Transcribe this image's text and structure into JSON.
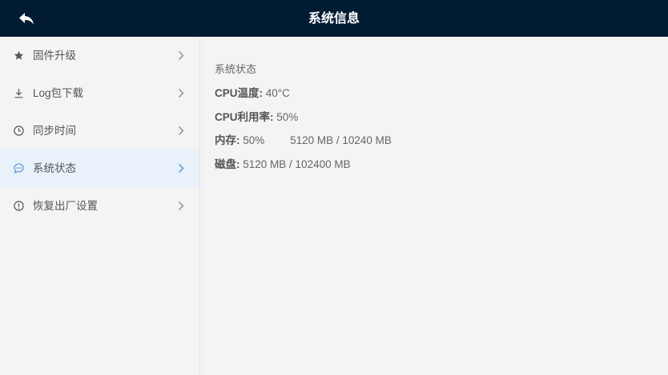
{
  "header": {
    "title": "系统信息",
    "back_icon": "reply-arrow-icon"
  },
  "sidebar": {
    "items": [
      {
        "label": "固件升级",
        "icon": "star-icon",
        "active": false
      },
      {
        "label": "Log包下载",
        "icon": "download-icon",
        "active": false
      },
      {
        "label": "同步时间",
        "icon": "clock-icon",
        "active": false
      },
      {
        "label": "系统状态",
        "icon": "chat-bubble-icon",
        "active": true
      },
      {
        "label": "恢复出厂设置",
        "icon": "info-circle-icon",
        "active": false
      }
    ]
  },
  "main": {
    "section_title": "系统状态",
    "cpu_temp": {
      "label": "CPU温度:",
      "value": "40°C"
    },
    "cpu_usage": {
      "label": "CPU利用率:",
      "value": "50%"
    },
    "memory": {
      "label": "内存:",
      "value": "50%",
      "detail": "5120 MB / 10240 MB"
    },
    "disk": {
      "label": "磁盘:",
      "value": "5120 MB / 102400 MB"
    }
  },
  "colors": {
    "header_bg": "#011b33",
    "active_item_bg": "#e9f1fb",
    "accent": "#4a90d9"
  }
}
